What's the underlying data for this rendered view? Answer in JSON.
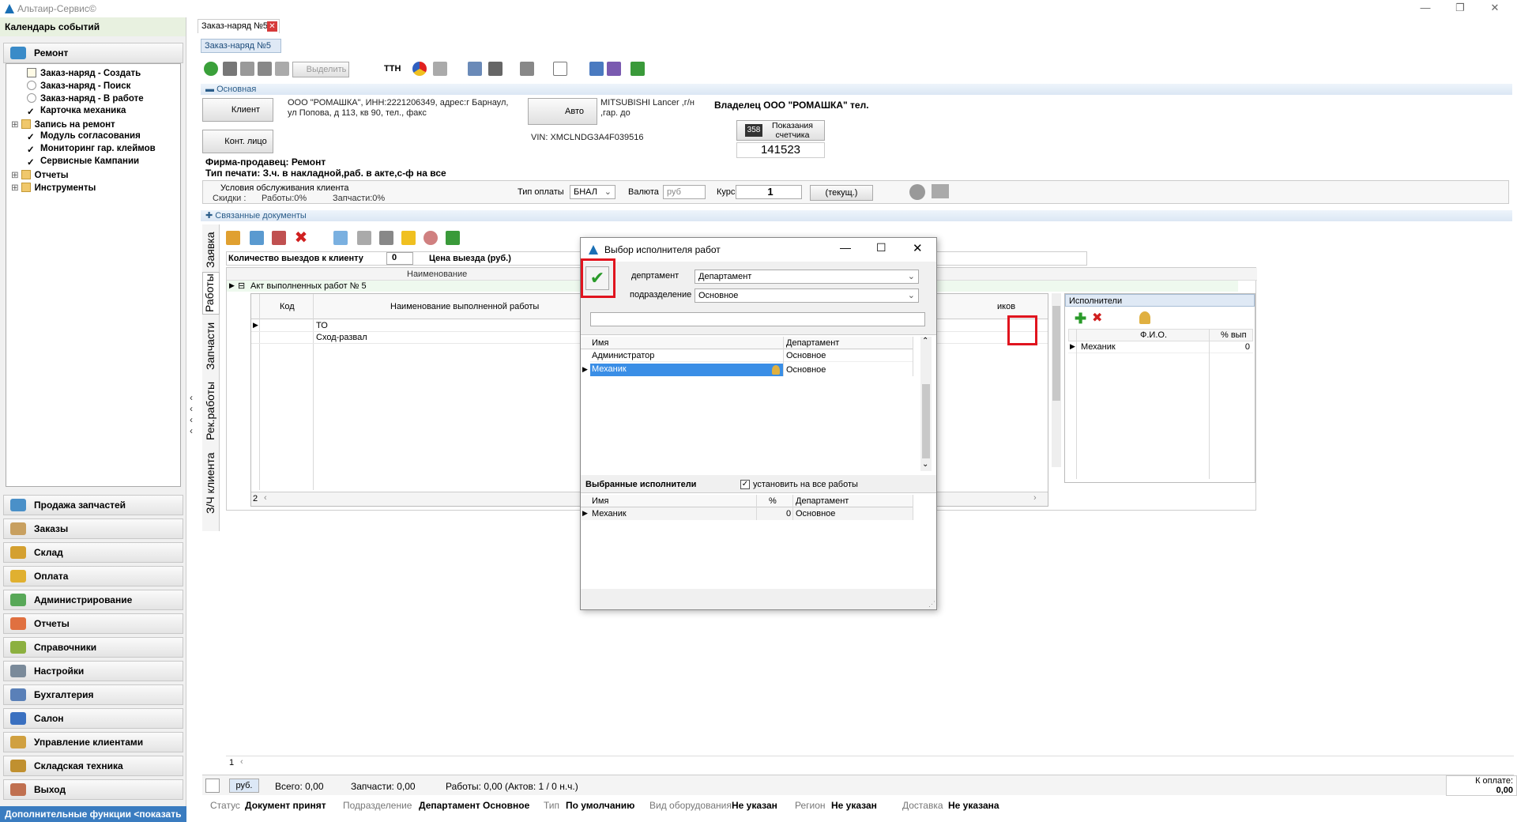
{
  "window": {
    "title": "Альтаир-Сервис©",
    "min": "—",
    "max": "❐",
    "close": "✕"
  },
  "left": {
    "calendar": "Календарь событий",
    "repair": "Ремонт",
    "tree": [
      "Заказ-наряд - Создать",
      "Заказ-наряд - Поиск",
      "Заказ-наряд - В работе",
      "Карточка механика",
      "Запись на ремонт",
      "Модуль согласования",
      "Мониторинг гар. клеймов",
      "Сервисные Кампании",
      "Отчеты",
      "Инструменты"
    ],
    "nav": [
      "Продажа запчастей",
      "Заказы",
      "Склад",
      "Оплата",
      "Администрирование",
      "Отчеты",
      "Справочники",
      "Настройки",
      "Бухгалтерия",
      "Салон",
      "Управление клиентами",
      "Складская техника",
      "Выход"
    ],
    "more": "Дополнительные функции <показать"
  },
  "doc": {
    "tab": "Заказ-наряд №5",
    "subtab": "Заказ-наряд №5",
    "tb_allocate": "Выделить",
    "tb_tti": "ТТН",
    "sec_main": "Основная",
    "client_btn": "Клиент",
    "client_text": "ООО \"РОМАШКА\", ИНН:2221206349, адрес:г Барнаул, ул Попова, д 113, кв 90, тел., факс",
    "contact_btn": "Конт. лицо",
    "auto_btn": "Авто",
    "auto_text": "MITSUBISHI Lancer ,г/н ,гар. до",
    "vin": "VIN: XMCLNDG3A4F039516",
    "owner": "Владелец  ООО \"РОМАШКА\" тел.",
    "counter_lbl": "Показания счетчика",
    "counter_icon": "358",
    "counter_val": "141523",
    "firm": "Фирма-продавец: Ремонт",
    "print_type": "Тип печати: З.ч. в накладной,раб. в акте,с-ф на все",
    "cond_title": "Условия обслуживания клиента",
    "discounts": "Скидки :",
    "disc_works": "Работы:0%",
    "disc_parts": "Запчасти:0%",
    "pay_type_lbl": "Тип оплаты",
    "pay_type": "БНАЛ",
    "currency_lbl": "Валюта",
    "currency": "руб",
    "rate_lbl": "Курс",
    "rate": "1",
    "rate_btn": "(текущ.)",
    "sec_docs": "Связанные документы",
    "vtabs": [
      "Заявка",
      "Работы",
      "Запчасти",
      "Рек.работы",
      "З/Ч клиента"
    ],
    "visits_lbl": "Количество выездов к клиенту",
    "visits": "0",
    "visit_price_lbl": "Цена выезда (руб.)",
    "visit_price": "0",
    "col_name": "Наименование",
    "act": "Акт выполненных работ № 5",
    "col_code": "Код",
    "col_workname": "Наименование выполненной работы",
    "col_other": "иков",
    "works": [
      "ТО",
      "Сход-развал"
    ],
    "rows_count": "2",
    "performers_tab": "Исполнители",
    "perf_col_fio": "Ф.И.О.",
    "perf_col_pct": "% вып",
    "performers": [
      {
        "name": "Механик",
        "pct": "0"
      }
    ],
    "bottom_count": "1"
  },
  "dialog": {
    "title": "Выбор исполнителя работ",
    "dept_lbl": "депртамент",
    "dept": "Департамент",
    "sub_lbl": "подразделение",
    "sub": "Основное",
    "search": "",
    "col_name": "Имя",
    "col_dept": "Департамент",
    "rows": [
      {
        "name": "Администратор",
        "dept": "Основное"
      },
      {
        "name": "Механик",
        "dept": "Основное"
      }
    ],
    "selected_title": "Выбранные исполнители",
    "apply_all": "установить на все работы",
    "sel_col_name": "Имя",
    "sel_col_pct": "%",
    "sel_col_dept": "Департамент",
    "selected": [
      {
        "name": "Механик",
        "pct": "0",
        "dept": "Основное"
      }
    ]
  },
  "footer": {
    "currency": "руб.",
    "total": "Всего: 0,00",
    "parts": "Запчасти: 0,00",
    "works": "Работы: 0,00 (Актов: 1 / 0 н.ч.)",
    "to_pay_lbl": "К оплате:",
    "to_pay": "0,00",
    "status_lbl": "Статус",
    "status": "Документ принят",
    "division_lbl": "Подразделение",
    "division": "Департамент Основное",
    "type_lbl": "Тип",
    "type": "По умолчанию",
    "equip_lbl": "Вид оборудования",
    "equip": "Не указан",
    "region_lbl": "Регион",
    "region": "Не указан",
    "delivery_lbl": "Доставка",
    "delivery": "Не указана"
  }
}
